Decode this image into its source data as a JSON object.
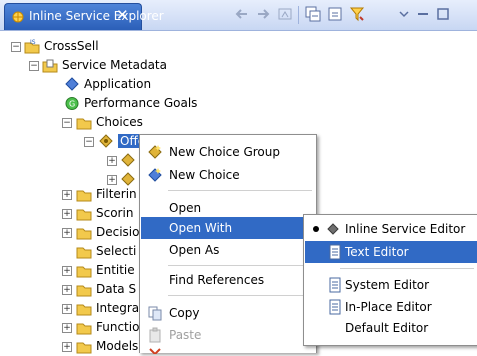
{
  "view": {
    "tab_title": "Inline Service Explorer",
    "close_glyph": "✕",
    "icons": [
      "back-icon",
      "forward-icon",
      "home-icon",
      "collapse-all-icon",
      "link-editor-icon",
      "filter-icon",
      "view-menu-icon",
      "minimize-icon",
      "maximize-icon"
    ]
  },
  "tree": {
    "root": "CrossSell",
    "service_metadata": "Service Metadata",
    "application": "Application",
    "performance_goals": "Performance Goals",
    "choices": "Choices",
    "offers": "Offers",
    "filtering": "Filterin",
    "scoring": "Scorin",
    "decisions": "Decisio",
    "selection": "Selecti",
    "entities": "Entitie",
    "data_sources": "Data S",
    "integration": "Integra",
    "functions": "Functio",
    "models": "Models"
  },
  "context_menu": {
    "new_choice_group": "New Choice Group",
    "new_choice": "New Choice",
    "open": "Open",
    "open_with": "Open With",
    "open_as": "Open As",
    "find_references": "Find References",
    "copy": "Copy",
    "paste": "Paste"
  },
  "submenu": {
    "inline_service_editor": "Inline Service Editor",
    "text_editor": "Text Editor",
    "system_editor": "System Editor",
    "in_place_editor": "In-Place Editor",
    "default_editor": "Default Editor"
  },
  "colors": {
    "selection": "#316ac5",
    "tab": "#2b5fb8",
    "folder": "#f2c94c"
  }
}
